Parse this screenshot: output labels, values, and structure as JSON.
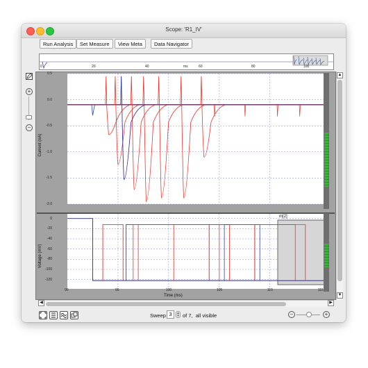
{
  "window": {
    "title": "Scope: 'R1_IV'"
  },
  "toolbar": {
    "run_analysis": "Run Analysis",
    "set_measure": "Set Measure",
    "view_meta": "View Meta",
    "data_navigator": "Data Navigator"
  },
  "overview": {
    "ticks": [
      "0",
      "20",
      "40",
      "ms",
      "60",
      "80",
      "100"
    ]
  },
  "current_plot": {
    "ylabel": "Current (nA)",
    "yticks": [
      "0.5",
      "0.0",
      "-0.5",
      "-1.0",
      "-1.5",
      "-2.0"
    ]
  },
  "voltage_plot": {
    "ylabel": "Voltage (mV)",
    "yticks": [
      "0",
      "-20",
      "-40",
      "-60",
      "-80",
      "-100",
      "-120"
    ],
    "xlabel": "Time (ms)",
    "xticks": [
      "90",
      "95",
      "100",
      "105",
      "110",
      "115"
    ],
    "measure_label": "m[2]"
  },
  "bottom_bar": {
    "sweep_label": "Sweep",
    "sweep_value": "3",
    "sweep_suffix": "of 7,  all visible"
  },
  "icons": {
    "left_panel": [
      "edit-icon",
      "zoom-in-icon",
      "zoom-out-icon"
    ],
    "bottom_tools": [
      "fit-window-icon",
      "list-icon",
      "traces-icon",
      "copy-windows-icon"
    ]
  },
  "colors": {
    "trace_red": "#e8322b",
    "trace_blue": "#2a3fb4",
    "trace_navy": "#2b2f78",
    "grid_blue": "#7a82e0",
    "meter_green": "#3bb33b"
  },
  "chart_data": [
    {
      "type": "line",
      "title": "",
      "xlabel": "",
      "ylabel": "Current (nA)",
      "xlim": [
        90,
        115.5
      ],
      "ylim": [
        -2.0,
        0.5
      ],
      "series_note_free": true,
      "series": [
        {
          "color": "red",
          "x": [
            94.1,
            95.0,
            95.6,
            96.6,
            97.8,
            99.3,
            101.5,
            103.5
          ],
          "y": [
            -0.67,
            -1.24,
            -1.52,
            -1.72,
            -1.95,
            -1.88,
            -1.88,
            -1.1
          ]
        },
        {
          "color": "blue",
          "x": [
            95.6
          ],
          "y": [
            -1.53
          ]
        }
      ]
    },
    {
      "type": "line",
      "title": "",
      "xlabel": "Time (ms)",
      "ylabel": "Voltage (mV)",
      "xlim": [
        90,
        115.5
      ],
      "ylim": [
        -130,
        5
      ],
      "series": [
        {
          "color": "navy",
          "x": [
            90,
            92.5,
            92.5,
            115.5
          ],
          "y": [
            0,
            0,
            -122,
            -122
          ]
        },
        {
          "color": "red",
          "x": [
            93.5,
            93.5,
            95.5,
            95.5
          ],
          "y": [
            -122,
            -12,
            -12,
            -122
          ]
        },
        {
          "color": "blue",
          "x": [
            95.8,
            95.8,
            108.5,
            108.5
          ],
          "y": [
            -122,
            -12,
            -12,
            -122
          ]
        }
      ]
    }
  ]
}
